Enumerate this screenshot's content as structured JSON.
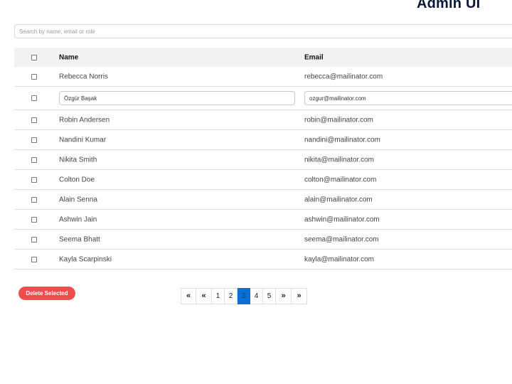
{
  "header": {
    "title": "Admin UI"
  },
  "search": {
    "placeholder": "Search by name, email or role",
    "value": ""
  },
  "table": {
    "columns": {
      "name": "Name",
      "email": "Email"
    },
    "rows": [
      {
        "name": "Rebecca Norris",
        "email": "rebecca@mailinator.com",
        "editing": false
      },
      {
        "name": "Özgür Başak",
        "email": "ozgur@mailinator.com",
        "editing": true
      },
      {
        "name": "Robin Andersen",
        "email": "robin@mailinator.com",
        "editing": false
      },
      {
        "name": "Nandini Kumar",
        "email": "nandini@mailinator.com",
        "editing": false
      },
      {
        "name": "Nikita Smith",
        "email": "nikita@mailinator.com",
        "editing": false
      },
      {
        "name": "Colton Doe",
        "email": "colton@mailinator.com",
        "editing": false
      },
      {
        "name": "Alain Senna",
        "email": "alain@mailinator.com",
        "editing": false
      },
      {
        "name": "Ashwin Jain",
        "email": "ashwin@mailinator.com",
        "editing": false
      },
      {
        "name": "Seema Bhatt",
        "email": "seema@mailinator.com",
        "editing": false
      },
      {
        "name": "Kayla Scarpinski",
        "email": "kayla@mailinator.com",
        "editing": false
      }
    ]
  },
  "actions": {
    "delete_label": "Delete Selected",
    "delete_color": "#ee4d4d"
  },
  "pagination": {
    "first_label": "«",
    "prev_label": "«",
    "pages": [
      "1",
      "2",
      "3",
      "4",
      "5"
    ],
    "current": "3",
    "next_label": "»",
    "last_label": "»",
    "active_color": "#0b6fd6"
  }
}
